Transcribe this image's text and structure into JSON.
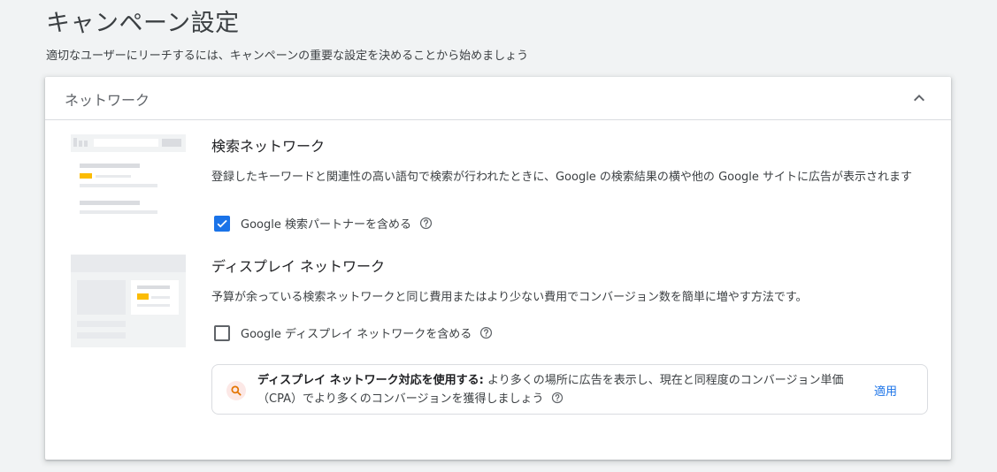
{
  "page": {
    "title": "キャンペーン設定",
    "subtitle": "適切なユーザーにリーチするには、キャンペーンの重要な設定を決めることから始めましょう"
  },
  "network_card": {
    "title": "ネットワーク",
    "collapse_icon": "chevron-up-icon",
    "search_network": {
      "title": "検索ネットワーク",
      "description": "登録したキーワードと関連性の高い語句で検索が行われたときに、Google の検索結果の横や他の Google サイトに広告が表示されます",
      "checkbox_label": "Google 検索パートナーを含める",
      "checked": true
    },
    "display_network": {
      "title": "ディスプレイ ネットワーク",
      "description": "予算が余っている検索ネットワークと同じ費用またはより少ない費用でコンバージョン数を簡単に増やす方法です。",
      "checkbox_label": "Google ディスプレイ ネットワークを含める",
      "checked": false
    },
    "recommendation": {
      "icon": "search-icon",
      "bold_text": "ディスプレイ ネットワーク対応を使用する:",
      "text": "より多くの場所に広告を表示し、現在と同程度のコンバージョン単価（CPA）でより多くのコンバージョンを獲得しましょう",
      "apply_label": "適用"
    }
  },
  "colors": {
    "accent": "#1a73e8",
    "illustration_highlight": "#fbbc04",
    "recommendation_icon": "#e37400"
  }
}
